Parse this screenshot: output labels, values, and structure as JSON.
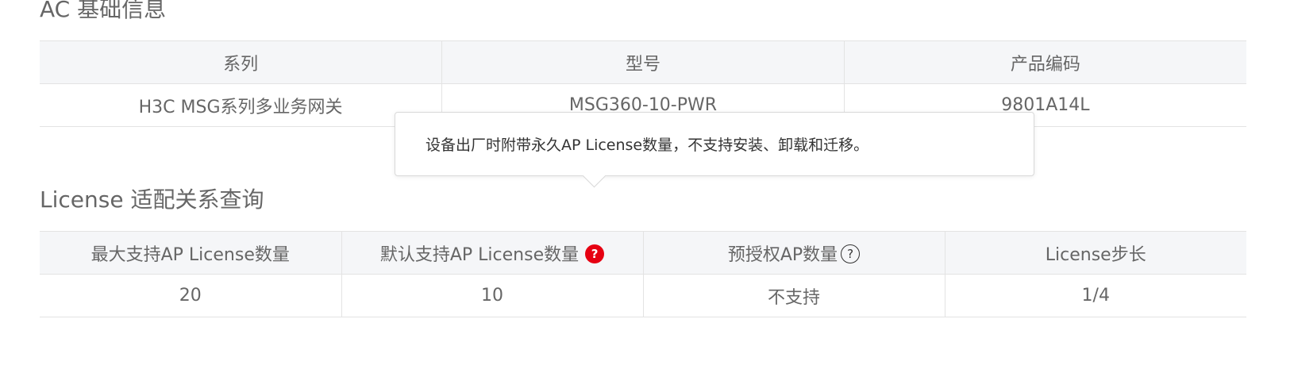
{
  "ac_info": {
    "title": "AC 基础信息",
    "columns": [
      "系列",
      "型号",
      "产品编码"
    ],
    "row": [
      "H3C MSG系列多业务网关",
      "MSG360-10-PWR",
      "9801A14L"
    ]
  },
  "license": {
    "title": "License 适配关系查询",
    "columns": [
      "最大支持AP License数量",
      "默认支持AP License数量",
      "预授权AP数量",
      "License步长"
    ],
    "row": [
      "20",
      "10",
      "不支持",
      "1/4"
    ],
    "help_icon_glyph": "?"
  },
  "tooltip": {
    "text": "设备出厂时附带永久AP License数量，不支持安装、卸载和迁移。"
  },
  "colors": {
    "header_bg": "#f5f6f8",
    "border": "#e3e3e3",
    "text": "#666666",
    "help_icon_active": "#e60012"
  }
}
